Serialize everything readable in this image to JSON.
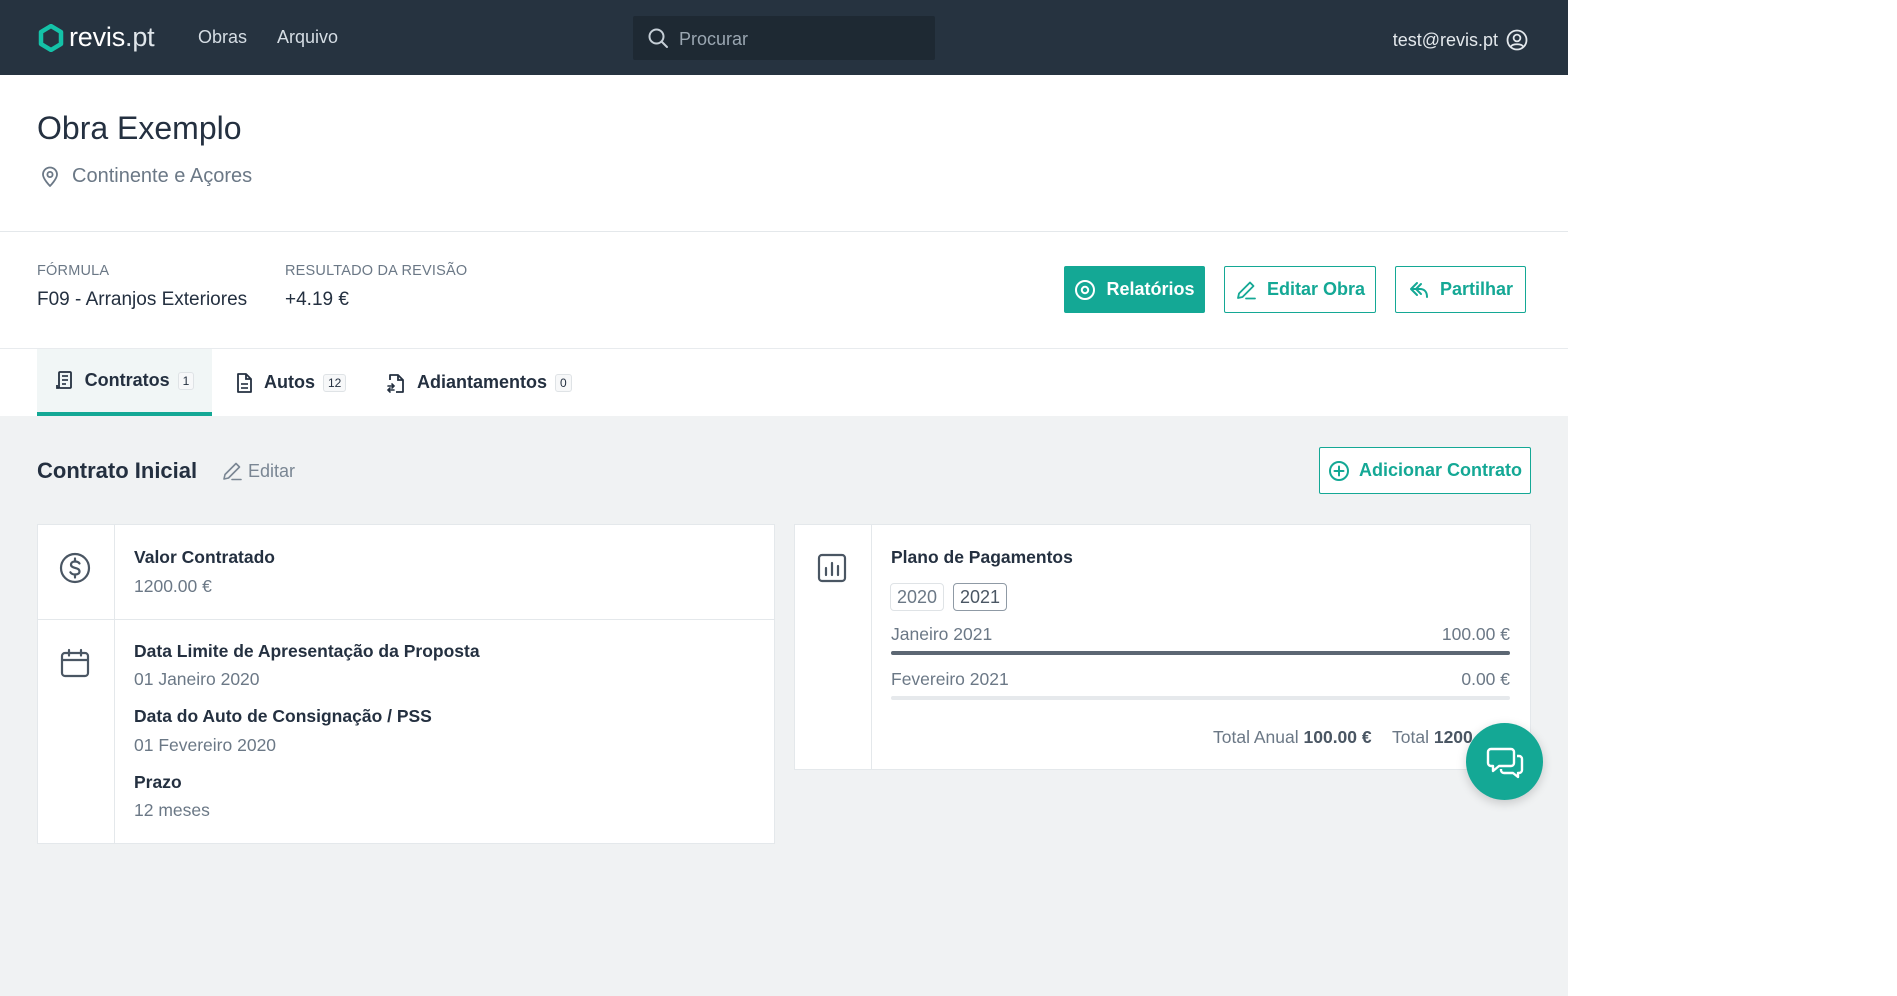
{
  "nav": {
    "logo_bold": "revis",
    "logo_light": ".pt",
    "links": [
      "Obras",
      "Arquivo"
    ],
    "search_placeholder": "Procurar",
    "user_email": "test@revis.pt"
  },
  "header": {
    "title": "Obra Exemplo",
    "location": "Continente e Açores"
  },
  "info": {
    "formula_label": "FÓRMULA",
    "formula_value": "F09 - Arranjos Exteriores",
    "result_label": "RESULTADO DA REVISÃO",
    "result_value": "+4.19 €"
  },
  "actions": {
    "relatorios": "Relatórios",
    "editar_obra": "Editar Obra",
    "partilhar": "Partilhar"
  },
  "tabs": [
    {
      "label": "Contratos",
      "count": "1"
    },
    {
      "label": "Autos",
      "count": "12"
    },
    {
      "label": "Adiantamentos",
      "count": "0"
    }
  ],
  "section": {
    "title": "Contrato Inicial",
    "edit_label": "Editar",
    "add_button": "Adicionar Contrato"
  },
  "contract": {
    "valor_label": "Valor Contratado",
    "valor_value": "1200.00 €",
    "data_limite_label": "Data Limite de Apresentação da Proposta",
    "data_limite_value": "01 Janeiro 2020",
    "data_auto_label": "Data do Auto de Consignação / PSS",
    "data_auto_value": "01 Fevereiro 2020",
    "prazo_label": "Prazo",
    "prazo_value": "12 meses"
  },
  "payments": {
    "title": "Plano de Pagamentos",
    "years": [
      "2020",
      "2021"
    ],
    "selected_year": "2021",
    "months": [
      {
        "name": "Janeiro 2021",
        "amount": "100.00 €",
        "fill": 1.0
      },
      {
        "name": "Fevereiro 2021",
        "amount": "0.00 €",
        "fill": 0.0
      }
    ],
    "total_anual_label": "Total Anual",
    "total_anual_value": "100.00 €",
    "total_label": "Total",
    "total_value": "1200"
  },
  "colors": {
    "accent": "#14a895",
    "navbar": "#263340"
  }
}
